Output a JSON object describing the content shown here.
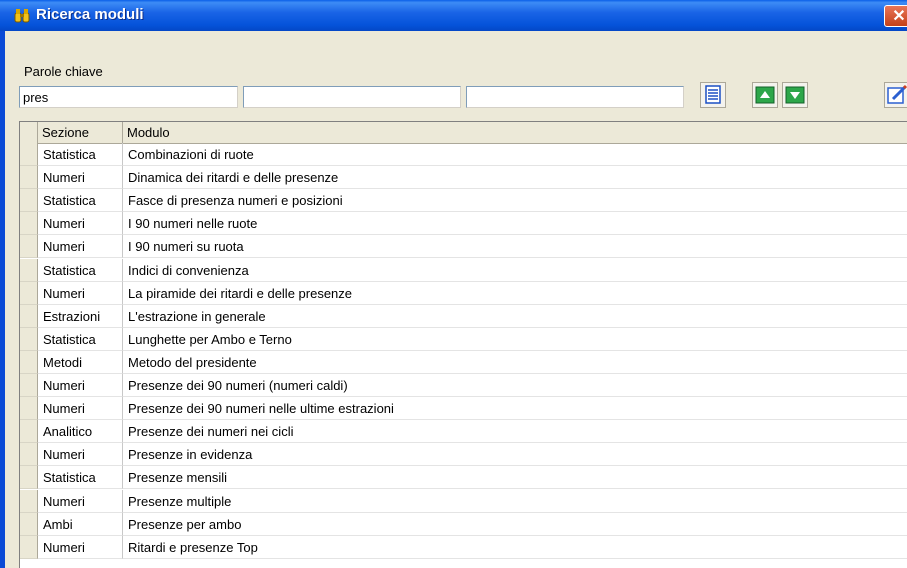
{
  "window": {
    "title": "Ricerca moduli",
    "close_glyph": "✕"
  },
  "search": {
    "label": "Parole chiave",
    "fields": [
      "pres",
      "",
      ""
    ]
  },
  "toolbar": {
    "icons": [
      "list-icon",
      "arrow-up-icon",
      "arrow-down-icon",
      "edit-icon"
    ],
    "colors": {
      "green": "#2DA64A",
      "blue": "#2B5FD0"
    }
  },
  "table": {
    "columns": [
      "Sezione",
      "Modulo"
    ],
    "rows": [
      [
        "Statistica",
        "Combinazioni di ruote"
      ],
      [
        "Numeri",
        "Dinamica dei ritardi e delle presenze"
      ],
      [
        "Statistica",
        "Fasce di presenza numeri e posizioni"
      ],
      [
        "Numeri",
        "I 90 numeri nelle ruote"
      ],
      [
        "Numeri",
        "I 90 numeri su ruota"
      ],
      [
        "Statistica",
        "Indici di convenienza"
      ],
      [
        "Numeri",
        "La piramide dei ritardi e delle presenze"
      ],
      [
        "Estrazioni",
        "L'estrazione in generale"
      ],
      [
        "Statistica",
        "Lunghette per Ambo e Terno"
      ],
      [
        "Metodi",
        "Metodo del presidente"
      ],
      [
        "Numeri",
        "Presenze dei 90 numeri (numeri caldi)"
      ],
      [
        "Numeri",
        "Presenze dei 90 numeri nelle ultime estrazioni"
      ],
      [
        "Analitico",
        "Presenze dei numeri nei cicli"
      ],
      [
        "Numeri",
        "Presenze in evidenza"
      ],
      [
        "Statistica",
        "Presenze mensili"
      ],
      [
        "Numeri",
        "Presenze multiple"
      ],
      [
        "Ambi",
        "Presenze per ambo"
      ],
      [
        "Numeri",
        "Ritardi e presenze Top"
      ]
    ]
  }
}
